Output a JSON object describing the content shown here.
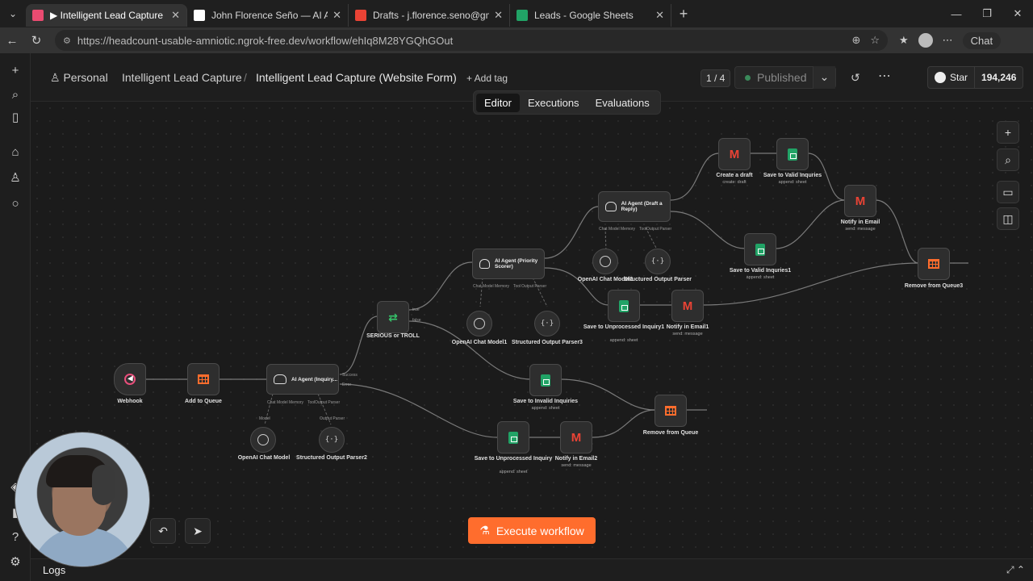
{
  "browser": {
    "tabs": [
      {
        "title": "▶ Intelligent Lead Capture (Websit",
        "active": true,
        "favicon_color": "#ea4b71"
      },
      {
        "title": "John Florence Seño — AI Automat",
        "active": false,
        "favicon_color": "#ffffff"
      },
      {
        "title": "Drafts - j.florence.seno@gmail.com",
        "active": false,
        "favicon_color": "#ea4335"
      },
      {
        "title": "Leads - Google Sheets",
        "active": false,
        "favicon_color": "#21a366"
      }
    ],
    "url": "https://headcount-usable-amniotic.ngrok-free.dev/workflow/ehIq8M28YGQhGOut",
    "chat_label": "Chat"
  },
  "header": {
    "project": "Personal",
    "folder": "Intelligent Lead Capture",
    "workflow_name": "Intelligent Lead Capture (Website Form)",
    "add_tag": "+ Add tag",
    "pager": "1 / 4",
    "status": "Published",
    "github_star": "Star",
    "github_count": "194,246"
  },
  "view_tabs": [
    "Editor",
    "Executions",
    "Evaluations"
  ],
  "nodes": {
    "webhook": {
      "label": "Webhook"
    },
    "add_queue": {
      "label": "Add to Queue"
    },
    "agent_inquiry": {
      "title": "AI Agent (Inquiry...",
      "port_success": "Success",
      "port_error": "Error"
    },
    "openai_model": {
      "label": "OpenAI Chat Model"
    },
    "parser2": {
      "label": "Structured Output Parser2"
    },
    "switch": {
      "label": "SERIOUS or TROLL",
      "port_true": "true",
      "port_false": "false"
    },
    "agent_priority": {
      "title": "AI Agent (Priority Scorer)"
    },
    "openai_model1": {
      "label": "OpenAI Chat Model1"
    },
    "parser3": {
      "label": "Structured Output Parser3"
    },
    "agent_draft": {
      "title": "AI Agent (Draft a Reply)"
    },
    "openai_model2": {
      "label": "OpenAI Chat Model2"
    },
    "parser": {
      "label": "Structured Output Parser"
    },
    "create_draft": {
      "label": "Create a draft",
      "sub": "create: draft"
    },
    "save_valid": {
      "label": "Save to Valid Inquries",
      "sub": "append: sheet"
    },
    "notify_email": {
      "label": "Notify in Email",
      "sub": "send: message"
    },
    "save_valid1": {
      "label": "Save to Valid Inquries1",
      "sub": "append: sheet"
    },
    "remove_queue3": {
      "label": "Remove from Queue3"
    },
    "save_unprocessed1": {
      "label": "Save to Unprocessed Inquiry1",
      "sub": "append: sheet"
    },
    "notify_email1": {
      "label": "Notify in Email1",
      "sub": "send: message"
    },
    "save_invalid": {
      "label": "Save to Invalid Inquiries",
      "sub": "append: sheet"
    },
    "remove_queue": {
      "label": "Remove from Queue"
    },
    "save_unprocessed": {
      "label": "Save to Unprocessed Inquiry",
      "sub": "append: sheet"
    },
    "notify_email2": {
      "label": "Notify in Email2",
      "sub": "send: message"
    }
  },
  "sub_ports": {
    "chat_model": "Chat Model",
    "memory": "Memory",
    "tool": "Tool",
    "output_parser": "Output Parser",
    "model": "Model"
  },
  "execute_label": "Execute workflow",
  "logs_label": "Logs",
  "colors": {
    "accent": "#ff6d2d",
    "sheets": "#21a366",
    "gmail": "#ea4335",
    "webhook": "#e94e7b",
    "switch": "#35c46a"
  }
}
